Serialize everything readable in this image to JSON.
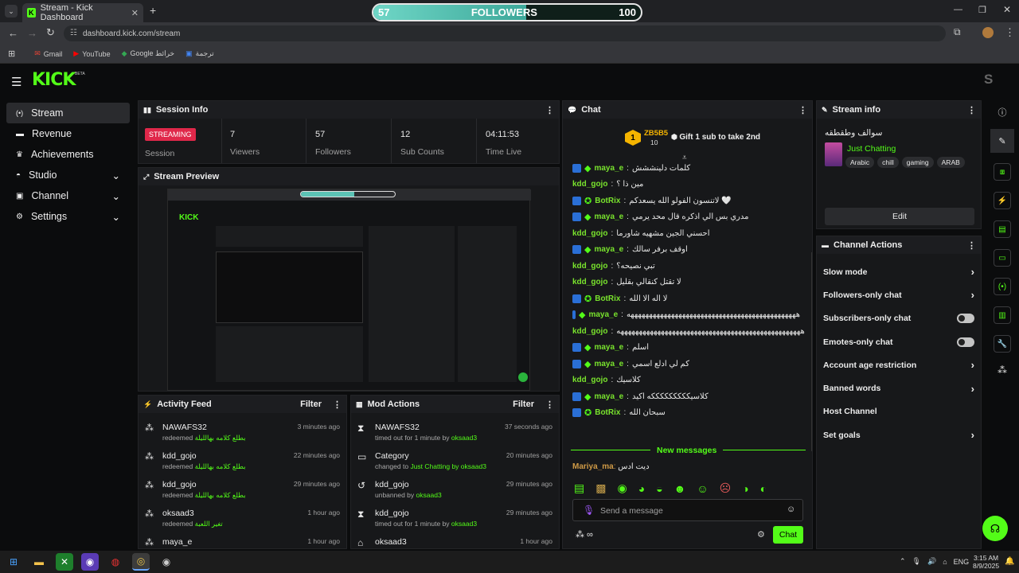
{
  "browser": {
    "tab_title": "Stream - Kick Dashboard",
    "url": "dashboard.kick.com/stream",
    "bookmarks": [
      "Gmail",
      "YouTube",
      "Google خرائط",
      "ترجمة"
    ]
  },
  "goal": {
    "current": "57",
    "label": "FOLLOWERS",
    "target": "100",
    "progress": 0.57
  },
  "brand": {
    "logo": "KICK",
    "beta": "BETA",
    "accent": "#53fc18",
    "avatar_letter": "S"
  },
  "sidebar": {
    "items": [
      {
        "label": "Stream",
        "icon": "broadcast-icon"
      },
      {
        "label": "Revenue",
        "icon": "revenue-icon"
      },
      {
        "label": "Achievements",
        "icon": "trophy-icon"
      },
      {
        "label": "Studio",
        "icon": "studio-icon"
      },
      {
        "label": "Channel",
        "icon": "channel-icon"
      },
      {
        "label": "Settings",
        "icon": "gear-icon"
      }
    ]
  },
  "session": {
    "title": "Session Info",
    "badge": "STREAMING",
    "badge_caption": "Session",
    "stats": [
      {
        "value": "7",
        "label": "Viewers"
      },
      {
        "value": "57",
        "label": "Followers"
      },
      {
        "value": "12",
        "label": "Sub Counts"
      },
      {
        "value": "04:11:53",
        "label": "Time Live"
      }
    ]
  },
  "preview": {
    "title": "Stream Preview"
  },
  "activity": {
    "title": "Activity Feed",
    "filter": "Filter",
    "items": [
      {
        "user": "NAWAFS32",
        "action": "redeemed",
        "detail": "بطلع كلامه بهالليلة",
        "time": "3 minutes ago"
      },
      {
        "user": "kdd_gojo",
        "action": "redeemed",
        "detail": "بطلع كلامه بهالليلة",
        "time": "22 minutes ago"
      },
      {
        "user": "kdd_gojo",
        "action": "redeemed",
        "detail": "بطلع كلامه بهالليلة",
        "time": "29 minutes ago"
      },
      {
        "user": "oksaad3",
        "action": "redeemed",
        "detail": "تغير اللعبة",
        "time": "1 hour ago"
      },
      {
        "user": "maya_e",
        "action": "",
        "detail": "",
        "time": "1 hour ago"
      }
    ]
  },
  "mod": {
    "title": "Mod Actions",
    "filter": "Filter",
    "items": [
      {
        "title": "NAWAFS32",
        "pre": "timed out for 1 minute by",
        "hl": "",
        "by": "oksaad3",
        "time": "37 seconds ago",
        "icon": "hourglass-icon"
      },
      {
        "title": "Category",
        "pre": "changed to",
        "hl": "Just Chatting",
        "by": "by oksaad3",
        "time": "20 minutes ago",
        "icon": "category-icon"
      },
      {
        "title": "kdd_gojo",
        "pre": "unbanned by",
        "hl": "",
        "by": "oksaad3",
        "time": "29 minutes ago",
        "icon": "undo-icon"
      },
      {
        "title": "kdd_gojo",
        "pre": "timed out for 1 minute by",
        "hl": "",
        "by": "oksaad3",
        "time": "29 minutes ago",
        "icon": "hourglass-icon"
      },
      {
        "title": "oksaad3",
        "pre": "",
        "hl": "",
        "by": "",
        "time": "1 hour ago",
        "icon": "hammer-icon"
      }
    ]
  },
  "chat": {
    "title": "Chat",
    "pinned_user": "ZB5B5",
    "pinned_count": "10",
    "gift_text": "Gift 1 sub to take 2nd",
    "lines": [
      {
        "user": "maya_e",
        "badge": true,
        "text": "كلمات دلينششش"
      },
      {
        "user": "kdd_gojo",
        "badge": false,
        "text": "مين ذا ؟"
      },
      {
        "user": "BotRix",
        "badge": true,
        "text": "لاتنسون الفولو الله يسعدكم 🤍"
      },
      {
        "user": "maya_e",
        "badge": true,
        "text": "مدري بس الي اذكره قال محد يرمي"
      },
      {
        "user": "kdd_gojo",
        "badge": false,
        "text": "احسني الجين مشهيه شاورما"
      },
      {
        "user": "maya_e",
        "badge": true,
        "text": "اوقف برفر سالك"
      },
      {
        "user": "kdd_gojo",
        "badge": false,
        "text": "تبي نصيحه؟"
      },
      {
        "user": "kdd_gojo",
        "badge": false,
        "text": "لا تقتل كنقالي بقليل"
      },
      {
        "user": "BotRix",
        "badge": true,
        "text": "لا اله الا الله"
      },
      {
        "user": "maya_e",
        "badge": true,
        "text": "ههههههههههههههههههههههههههههههههههههههههههههههه"
      },
      {
        "user": "kdd_gojo",
        "badge": false,
        "text": "ههههههههههههههههههههههههههههههههههههههههههههههههههه"
      },
      {
        "user": "maya_e",
        "badge": true,
        "text": "اسلم"
      },
      {
        "user": "maya_e",
        "badge": true,
        "text": "كم لي ادلع اسمي"
      },
      {
        "user": "kdd_gojo",
        "badge": false,
        "text": "كلاسيك"
      },
      {
        "user": "maya_e",
        "badge": true,
        "text": "كلاسيكككككككككه اكيد"
      },
      {
        "user": "BotRix",
        "badge": true,
        "text": "سبحان الله"
      }
    ],
    "new_messages": "New messages",
    "last_user": "Mariya_ma",
    "last_text": "ديت ادس",
    "placeholder": "Send a message",
    "send": "Chat"
  },
  "stream_info": {
    "title": "Stream info",
    "stream_title": "سوالف وطقطقه",
    "category": "Just Chatting",
    "tags": [
      "Arabic",
      "chill",
      "gaming",
      "ARAB"
    ],
    "edit": "Edit"
  },
  "channel_actions": {
    "title": "Channel Actions",
    "items": [
      {
        "label": "Slow mode",
        "control": "chevron"
      },
      {
        "label": "Followers-only chat",
        "control": "chevron"
      },
      {
        "label": "Subscribers-only chat",
        "control": "toggle"
      },
      {
        "label": "Emotes-only chat",
        "control": "toggle"
      },
      {
        "label": "Account age restriction",
        "control": "chevron"
      },
      {
        "label": "Banned words",
        "control": "chevron"
      },
      {
        "label": "Host Channel",
        "control": "none"
      },
      {
        "label": "Set goals",
        "control": "chevron"
      }
    ]
  },
  "taskbar": {
    "lang": "ENG",
    "time": "3:15 AM",
    "date": "8/9/2025"
  }
}
